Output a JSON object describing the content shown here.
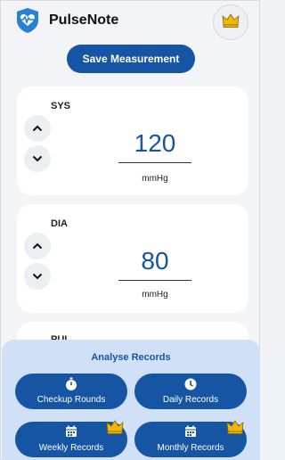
{
  "header": {
    "title": "PulseNote",
    "logo_icon": "heart-shield-icon",
    "premium_icon": "crown-icon"
  },
  "actions": {
    "save_label": "Save Measurement"
  },
  "measurements": [
    {
      "label": "SYS",
      "value": "120",
      "unit": "mmHg"
    },
    {
      "label": "DIA",
      "value": "80",
      "unit": "mmHg"
    },
    {
      "label": "PUL"
    }
  ],
  "analyse": {
    "title": "Analyse Records",
    "buttons": [
      {
        "label": "Checkup Rounds",
        "icon": "stopwatch-icon",
        "premium": false
      },
      {
        "label": "Daily Records",
        "icon": "clock-icon",
        "premium": false
      },
      {
        "label": "Weekly Records",
        "icon": "calendar-icon",
        "premium": true
      },
      {
        "label": "Monthly Records",
        "icon": "calendar-icon",
        "premium": true
      }
    ]
  },
  "colors": {
    "accent": "#1655a4",
    "panel": "#cfe0f7",
    "crown": "#f2b705",
    "background": "#f3f4f8"
  }
}
